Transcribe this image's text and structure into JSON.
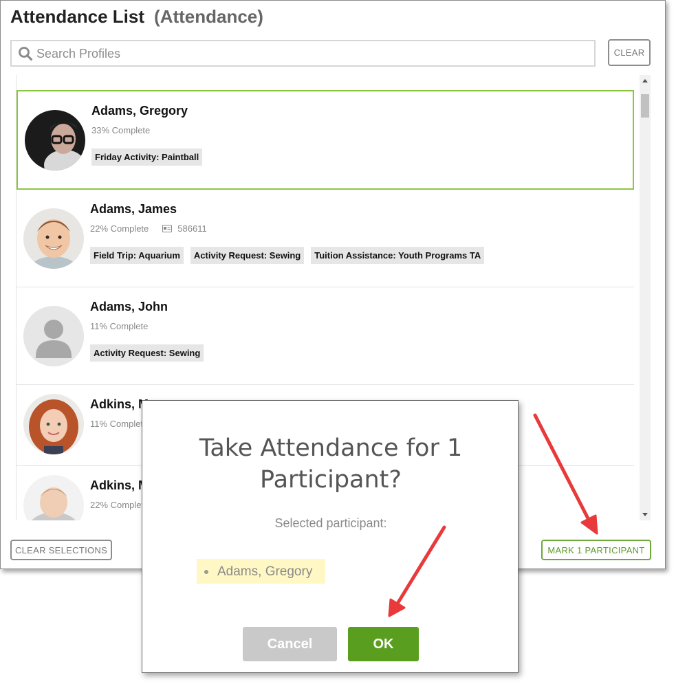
{
  "header": {
    "title": "Attendance List",
    "subtitle": "(Attendance)"
  },
  "search": {
    "placeholder": "Search Profiles",
    "icon": "search-icon",
    "clear_label": "CLEAR"
  },
  "participants": [
    {
      "name": "Adams, Gregory",
      "progress": "33% Complete",
      "id": "",
      "tags": [
        "Friday Activity: Paintball"
      ],
      "selected": true
    },
    {
      "name": "Adams, James",
      "progress": "22% Complete",
      "id": "586611",
      "tags": [
        "Field Trip: Aquarium",
        "Activity Request: Sewing",
        "Tuition Assistance: Youth Programs TA"
      ],
      "selected": false
    },
    {
      "name": "Adams, John",
      "progress": "11% Complete",
      "id": "",
      "tags": [
        "Activity Request: Sewing"
      ],
      "selected": false
    },
    {
      "name": "Adkins, M",
      "progress": "11% Complet",
      "id": "",
      "tags": [],
      "selected": false
    },
    {
      "name": "Adkins, M",
      "progress": "22% Complet",
      "id": "",
      "tags": [],
      "selected": false
    }
  ],
  "footer": {
    "clear_selections_label": "CLEAR SELECTIONS",
    "mark_label": "MARK 1 PARTICIPANT"
  },
  "dialog": {
    "title_line1": "Take Attendance for 1",
    "title_line2": "Participant?",
    "selected_label": "Selected participant:",
    "selected_items": [
      "Adams, Gregory"
    ],
    "cancel_label": "Cancel",
    "ok_label": "OK"
  },
  "colors": {
    "accent_green": "#5a9e1f",
    "selection_border": "#8cc63f",
    "highlight": "#fff8c4",
    "annotation_arrow": "#e8393b"
  }
}
